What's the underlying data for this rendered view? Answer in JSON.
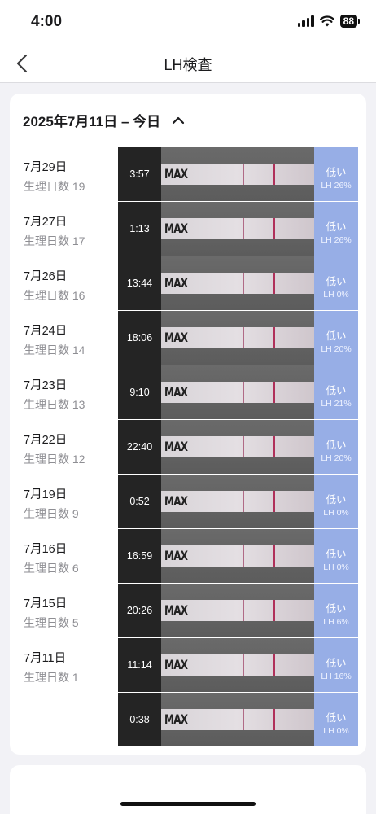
{
  "status_bar": {
    "time": "4:00",
    "battery": "88"
  },
  "nav": {
    "title": "LH検査"
  },
  "range": {
    "label": "2025年7月11日 – 今日"
  },
  "colors": {
    "result_bg": "#97aee6",
    "control_line": "#b0305a"
  },
  "entries": [
    {
      "date": "7月29日",
      "cycle_day": "生理日数 19",
      "time": "3:57",
      "level": "低い",
      "lh": "LH 26%"
    },
    {
      "date": "7月27日",
      "cycle_day": "生理日数 17",
      "time": "1:13",
      "level": "低い",
      "lh": "LH 26%"
    },
    {
      "date": "7月26日",
      "cycle_day": "生理日数 16",
      "time": "13:44",
      "level": "低い",
      "lh": "LH 0%"
    },
    {
      "date": "7月24日",
      "cycle_day": "生理日数 14",
      "time": "18:06",
      "level": "低い",
      "lh": "LH 20%"
    },
    {
      "date": "7月23日",
      "cycle_day": "生理日数 13",
      "time": "9:10",
      "level": "低い",
      "lh": "LH 21%"
    },
    {
      "date": "7月22日",
      "cycle_day": "生理日数 12",
      "time": "22:40",
      "level": "低い",
      "lh": "LH 20%"
    },
    {
      "date": "7月19日",
      "cycle_day": "生理日数 9",
      "time": "0:52",
      "level": "低い",
      "lh": "LH 0%"
    },
    {
      "date": "7月16日",
      "cycle_day": "生理日数 6",
      "time": "16:59",
      "level": "低い",
      "lh": "LH 0%"
    },
    {
      "date": "7月15日",
      "cycle_day": "生理日数 5",
      "time": "20:26",
      "level": "低い",
      "lh": "LH 6%"
    },
    {
      "date": "7月11日",
      "cycle_day": "生理日数 1",
      "time": "11:14",
      "level": "低い",
      "lh": "LH 16%"
    },
    {
      "date": "",
      "cycle_day": "",
      "time": "0:38",
      "level": "低い",
      "lh": "LH 0%"
    }
  ],
  "strip_brand": "MAX"
}
